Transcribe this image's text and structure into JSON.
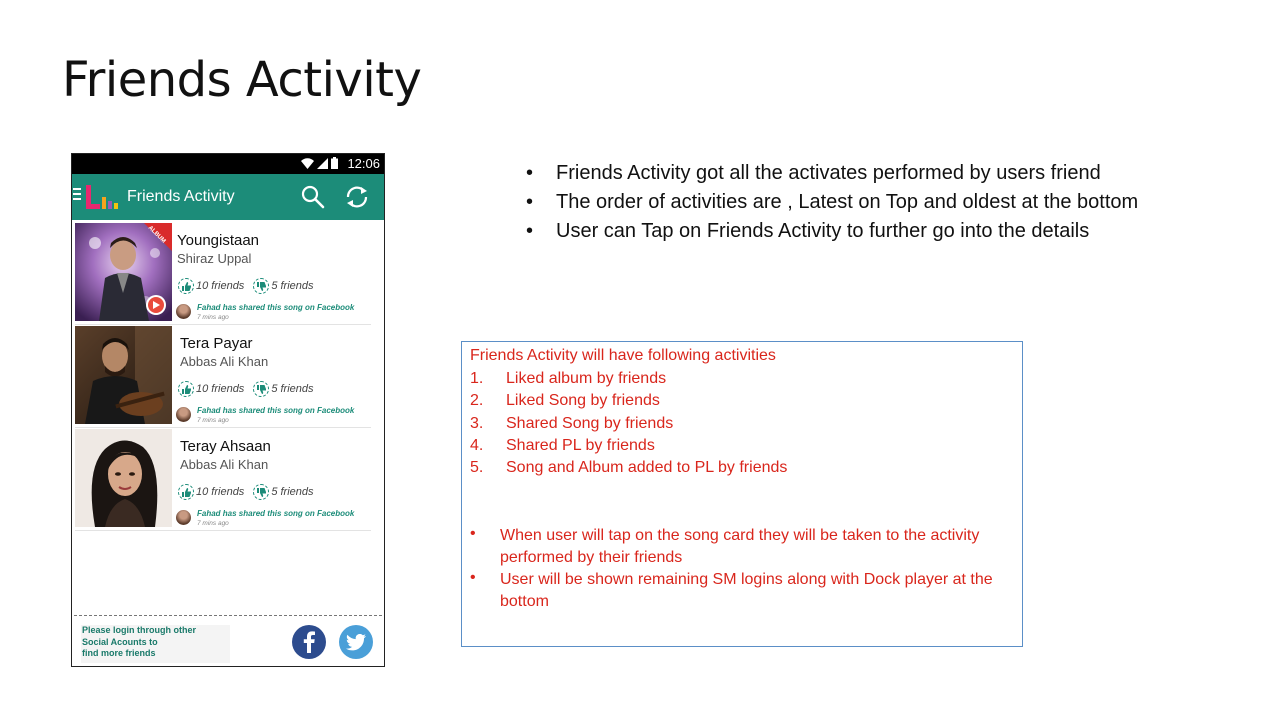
{
  "slide": {
    "title": "Friends Activity"
  },
  "phone": {
    "status_time": "12:06",
    "appbar_title": "Friends Activity",
    "cards": [
      {
        "song": "Youngistaan",
        "artist": "Shiraz Uppal",
        "badge": "ALBUM",
        "likes": "10 friends",
        "dislikes": "5 friends",
        "share": "Fahad has shared this song on Facebook",
        "time": "7 mins ago"
      },
      {
        "song": "Tera Payar",
        "artist": "Abbas Ali Khan",
        "likes": "10 friends",
        "dislikes": "5 friends",
        "share": "Fahad has shared this song on Facebook",
        "time": "7 mins ago"
      },
      {
        "song": "Teray Ahsaan",
        "artist": "Abbas Ali Khan",
        "likes": "10 friends",
        "dislikes": "5 friends",
        "share": "Fahad has shared this song on Facebook",
        "time": "7 mins ago"
      }
    ],
    "footer": {
      "line1": "Please login through other",
      "line2": "Social Acounts to",
      "line3": "find more friends"
    }
  },
  "bullets": [
    "Friends Activity got all the activates performed by users friend",
    "The order of activities are , Latest on Top and oldest at the bottom",
    "User can Tap on Friends Activity to further go into the details"
  ],
  "notebox": {
    "heading": "Friends Activity will have following activities",
    "numbered": [
      {
        "n": "1.",
        "text": "Liked album by friends"
      },
      {
        "n": "2.",
        "text": "Liked Song by friends"
      },
      {
        "n": "3.",
        "text": "Shared Song by friends"
      },
      {
        "n": "4.",
        "text": "Shared PL by friends"
      },
      {
        "n": "5.",
        "text": "Song and Album added to PL by friends"
      }
    ],
    "dots": [
      "When user will tap on the song card they will be taken to the activity performed by their friends",
      "User will be shown remaining SM logins along with Dock player at the bottom"
    ]
  },
  "colors": {
    "appbar": "#1c8c79",
    "note_text": "#d9261c",
    "note_border": "#5b8fc7",
    "facebook": "#2d4c8e",
    "twitter": "#4a9fd8"
  }
}
